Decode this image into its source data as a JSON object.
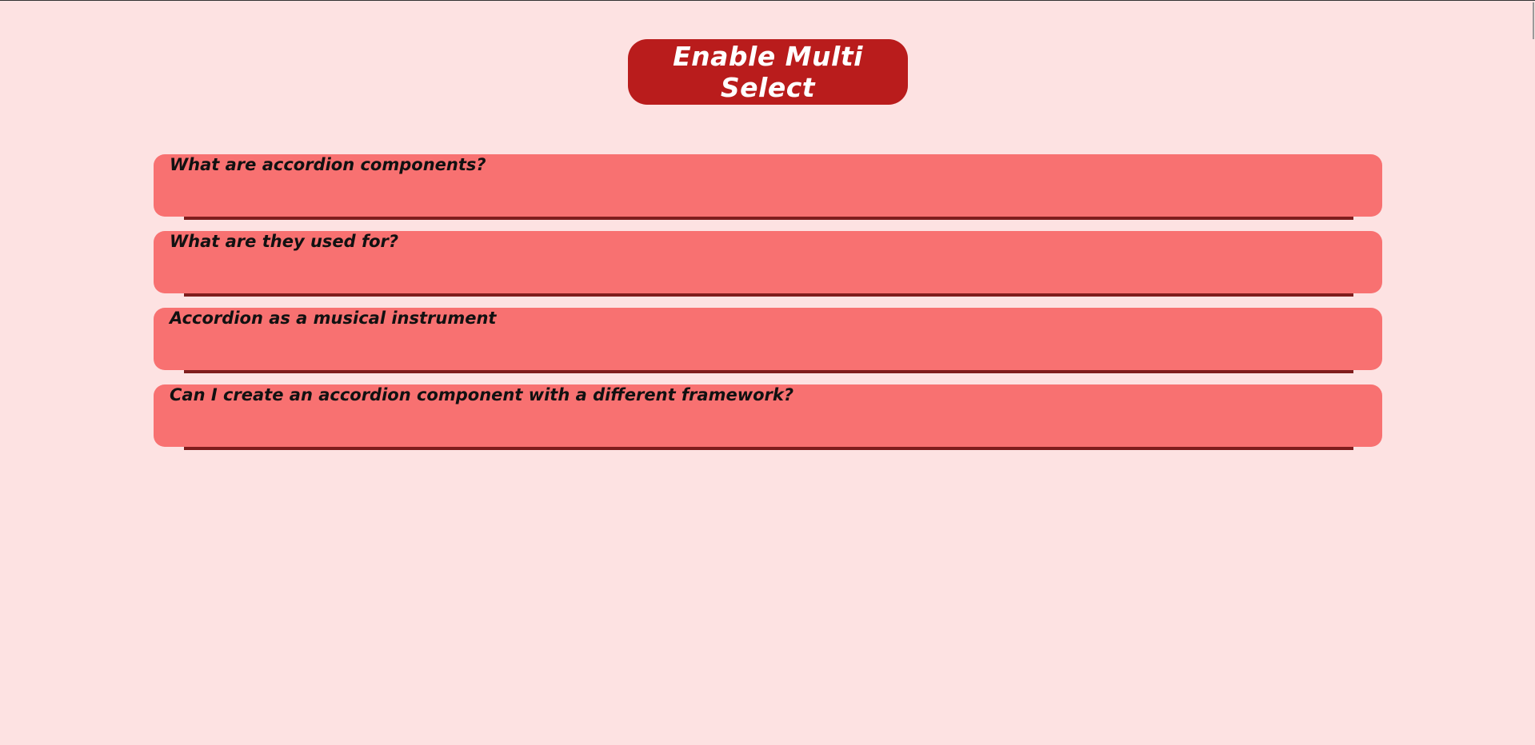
{
  "multi_select_button": {
    "label": "Enable Multi Select"
  },
  "accordion": {
    "items": [
      {
        "title": "What are accordion components?"
      },
      {
        "title": "What are they used for?"
      },
      {
        "title": "Accordion as a musical instrument"
      },
      {
        "title": "Can I create an accordion component with a different framework?"
      }
    ]
  },
  "colors": {
    "page_background": "#fde2e2",
    "button_background": "#b91c1c",
    "button_text": "#ffffff",
    "item_background": "#f87171",
    "panel_line": "#7f1d1d",
    "title_text": "#111111"
  }
}
